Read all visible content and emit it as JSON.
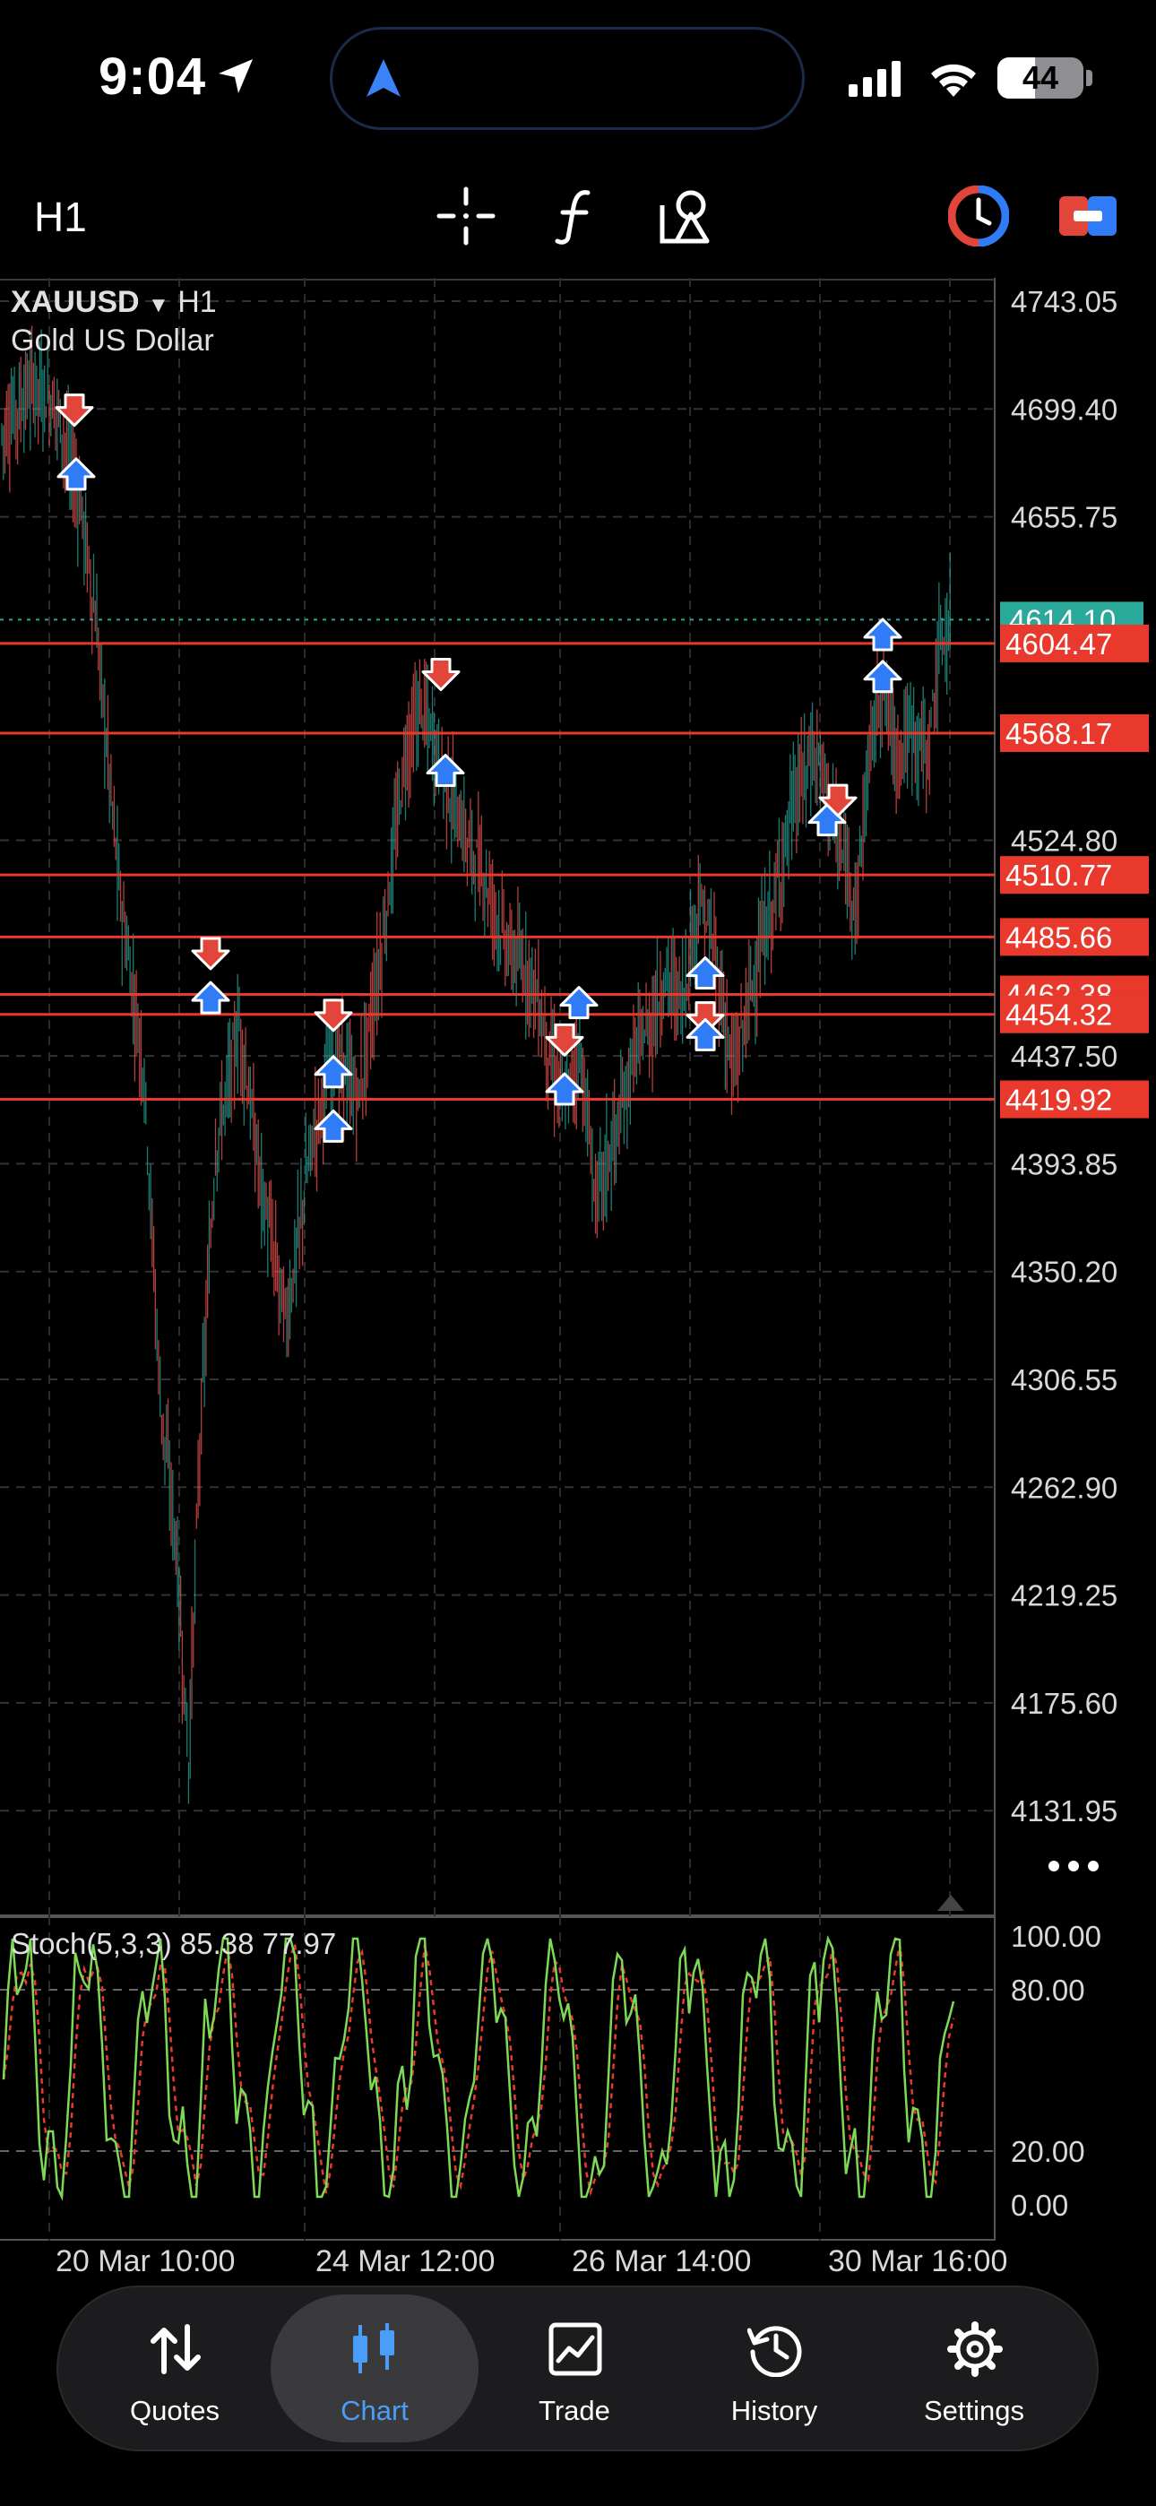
{
  "status_bar": {
    "time": "9:04",
    "battery_level": "44"
  },
  "toolbar": {
    "timeframe": "H1"
  },
  "chart": {
    "symbol": "XAUUSD",
    "timeframe": "H1",
    "description": "Gold US Dollar",
    "price_ticks": [
      "4743.05",
      "4699.40",
      "4655.75",
      "4524.80",
      "4437.50",
      "4393.85",
      "4350.20",
      "4306.55",
      "4262.90",
      "4219.25",
      "4175.60",
      "4131.95"
    ],
    "current_price": "4614.10",
    "levels": [
      "4604.47",
      "4568.17",
      "4510.77",
      "4485.66",
      "4462.38",
      "4454.32",
      "4419.92"
    ],
    "colors": {
      "level": "#e8392c",
      "current": "#2aa89a",
      "buy": "#2f7cf6",
      "sell": "#e2463a",
      "bull": "#26a69a",
      "bear": "#ef5350"
    }
  },
  "stochastic": {
    "label": "Stoch(5,3,3) 85.38 77.97",
    "ticks": [
      "100.00",
      "80.00",
      "20.00",
      "0.00"
    ],
    "main_color": "#7ed957",
    "signal_color": "#e8392c"
  },
  "time_axis": [
    "20 Mar 10:00",
    "24 Mar 12:00",
    "26 Mar 14:00",
    "30 Mar 16:00"
  ],
  "tabs": [
    {
      "label": "Quotes"
    },
    {
      "label": "Chart"
    },
    {
      "label": "Trade"
    },
    {
      "label": "History"
    },
    {
      "label": "Settings"
    }
  ],
  "icons": [
    "location-arrow-icon",
    "signal-icon",
    "wifi-icon",
    "crosshair-icon",
    "indicators-icon",
    "objects-icon",
    "one-click-trading-icon",
    "trade-toggle-icon",
    "more-icon"
  ]
}
